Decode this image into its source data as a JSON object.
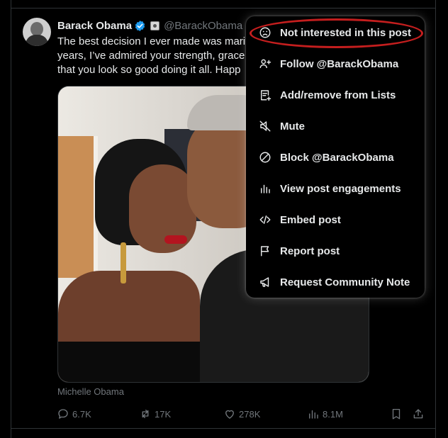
{
  "post": {
    "author_name": "Barack Obama",
    "handle": "@BarackObama",
    "text_lines": [
      "The best decision I ever made was mari",
      "years, I’ve admired your strength, grace",
      "that you look so good doing it all. Happ"
    ],
    "media_caption": "Michelle Obama",
    "icons": {
      "verified": "verified-badge-icon",
      "affiliation": "government-seal-icon"
    }
  },
  "actions": {
    "replies": "6.7K",
    "reposts": "17K",
    "likes": "278K",
    "views": "8.1M"
  },
  "menu": {
    "items": [
      {
        "label": "Not interested in this post",
        "icon": "frown-face-icon"
      },
      {
        "label": "Follow @BarackObama",
        "icon": "follow-user-icon"
      },
      {
        "label": "Add/remove from Lists",
        "icon": "lists-icon"
      },
      {
        "label": "Mute",
        "icon": "mute-icon"
      },
      {
        "label": "Block @BarackObama",
        "icon": "block-icon"
      },
      {
        "label": "View post engagements",
        "icon": "engagements-icon"
      },
      {
        "label": "Embed post",
        "icon": "embed-icon"
      },
      {
        "label": "Report post",
        "icon": "flag-icon"
      },
      {
        "label": "Request Community Note",
        "icon": "megaphone-icon"
      }
    ]
  },
  "colors": {
    "background": "#000000",
    "text": "#e7e9ea",
    "muted": "#71767b",
    "verified": "#1d9bf0",
    "highlight_ring": "#c41e1e"
  }
}
